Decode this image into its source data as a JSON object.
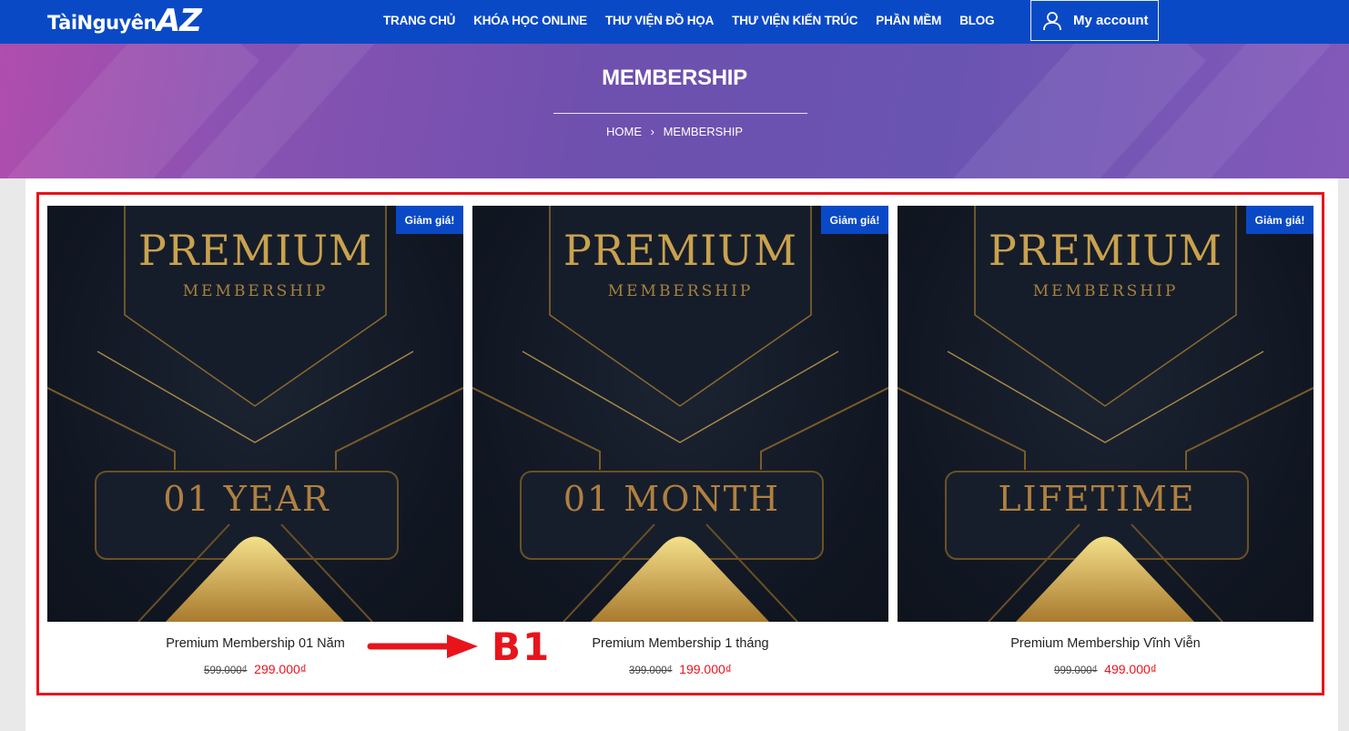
{
  "header": {
    "logo_part1": "TàiNguyên",
    "logo_part2": "AZ",
    "nav": [
      "TRANG CHỦ",
      "KHÓA HỌC ONLINE",
      "THƯ VIỆN ĐỒ HỌA",
      "THƯ VIỆN KIẾN TRÚC",
      "PHẦN MỀM",
      "BLOG"
    ],
    "account_label": "My account",
    "account_icon": "user-icon"
  },
  "banner": {
    "title": "MEMBERSHIP",
    "breadcrumb_home": "HOME",
    "breadcrumb_sep": "›",
    "breadcrumb_current": "MEMBERSHIP"
  },
  "products": [
    {
      "badge": "Giảm giá!",
      "img_title": "PREMIUM",
      "img_subtitle": "MEMBERSHIP",
      "img_plan": "01 YEAR",
      "name": "Premium Membership 01 Năm",
      "old_price": "599.000₫",
      "new_price": "299.000₫"
    },
    {
      "badge": "Giảm giá!",
      "img_title": "PREMIUM",
      "img_subtitle": "MEMBERSHIP",
      "img_plan": "01 MONTH",
      "name": "Premium Membership 1 tháng",
      "old_price": "399.000₫",
      "new_price": "199.000₫"
    },
    {
      "badge": "Giảm giá!",
      "img_title": "PREMIUM",
      "img_subtitle": "MEMBERSHIP",
      "img_plan": "LIFETIME",
      "name": "Premium Membership Vĩnh Viễn",
      "old_price": "999.000₫",
      "new_price": "499.000₫"
    }
  ],
  "annotation": {
    "label": "B1"
  },
  "colors": {
    "primary": "#0a49c6",
    "accent_red": "#e8141c",
    "gold": "#c9a24e"
  }
}
